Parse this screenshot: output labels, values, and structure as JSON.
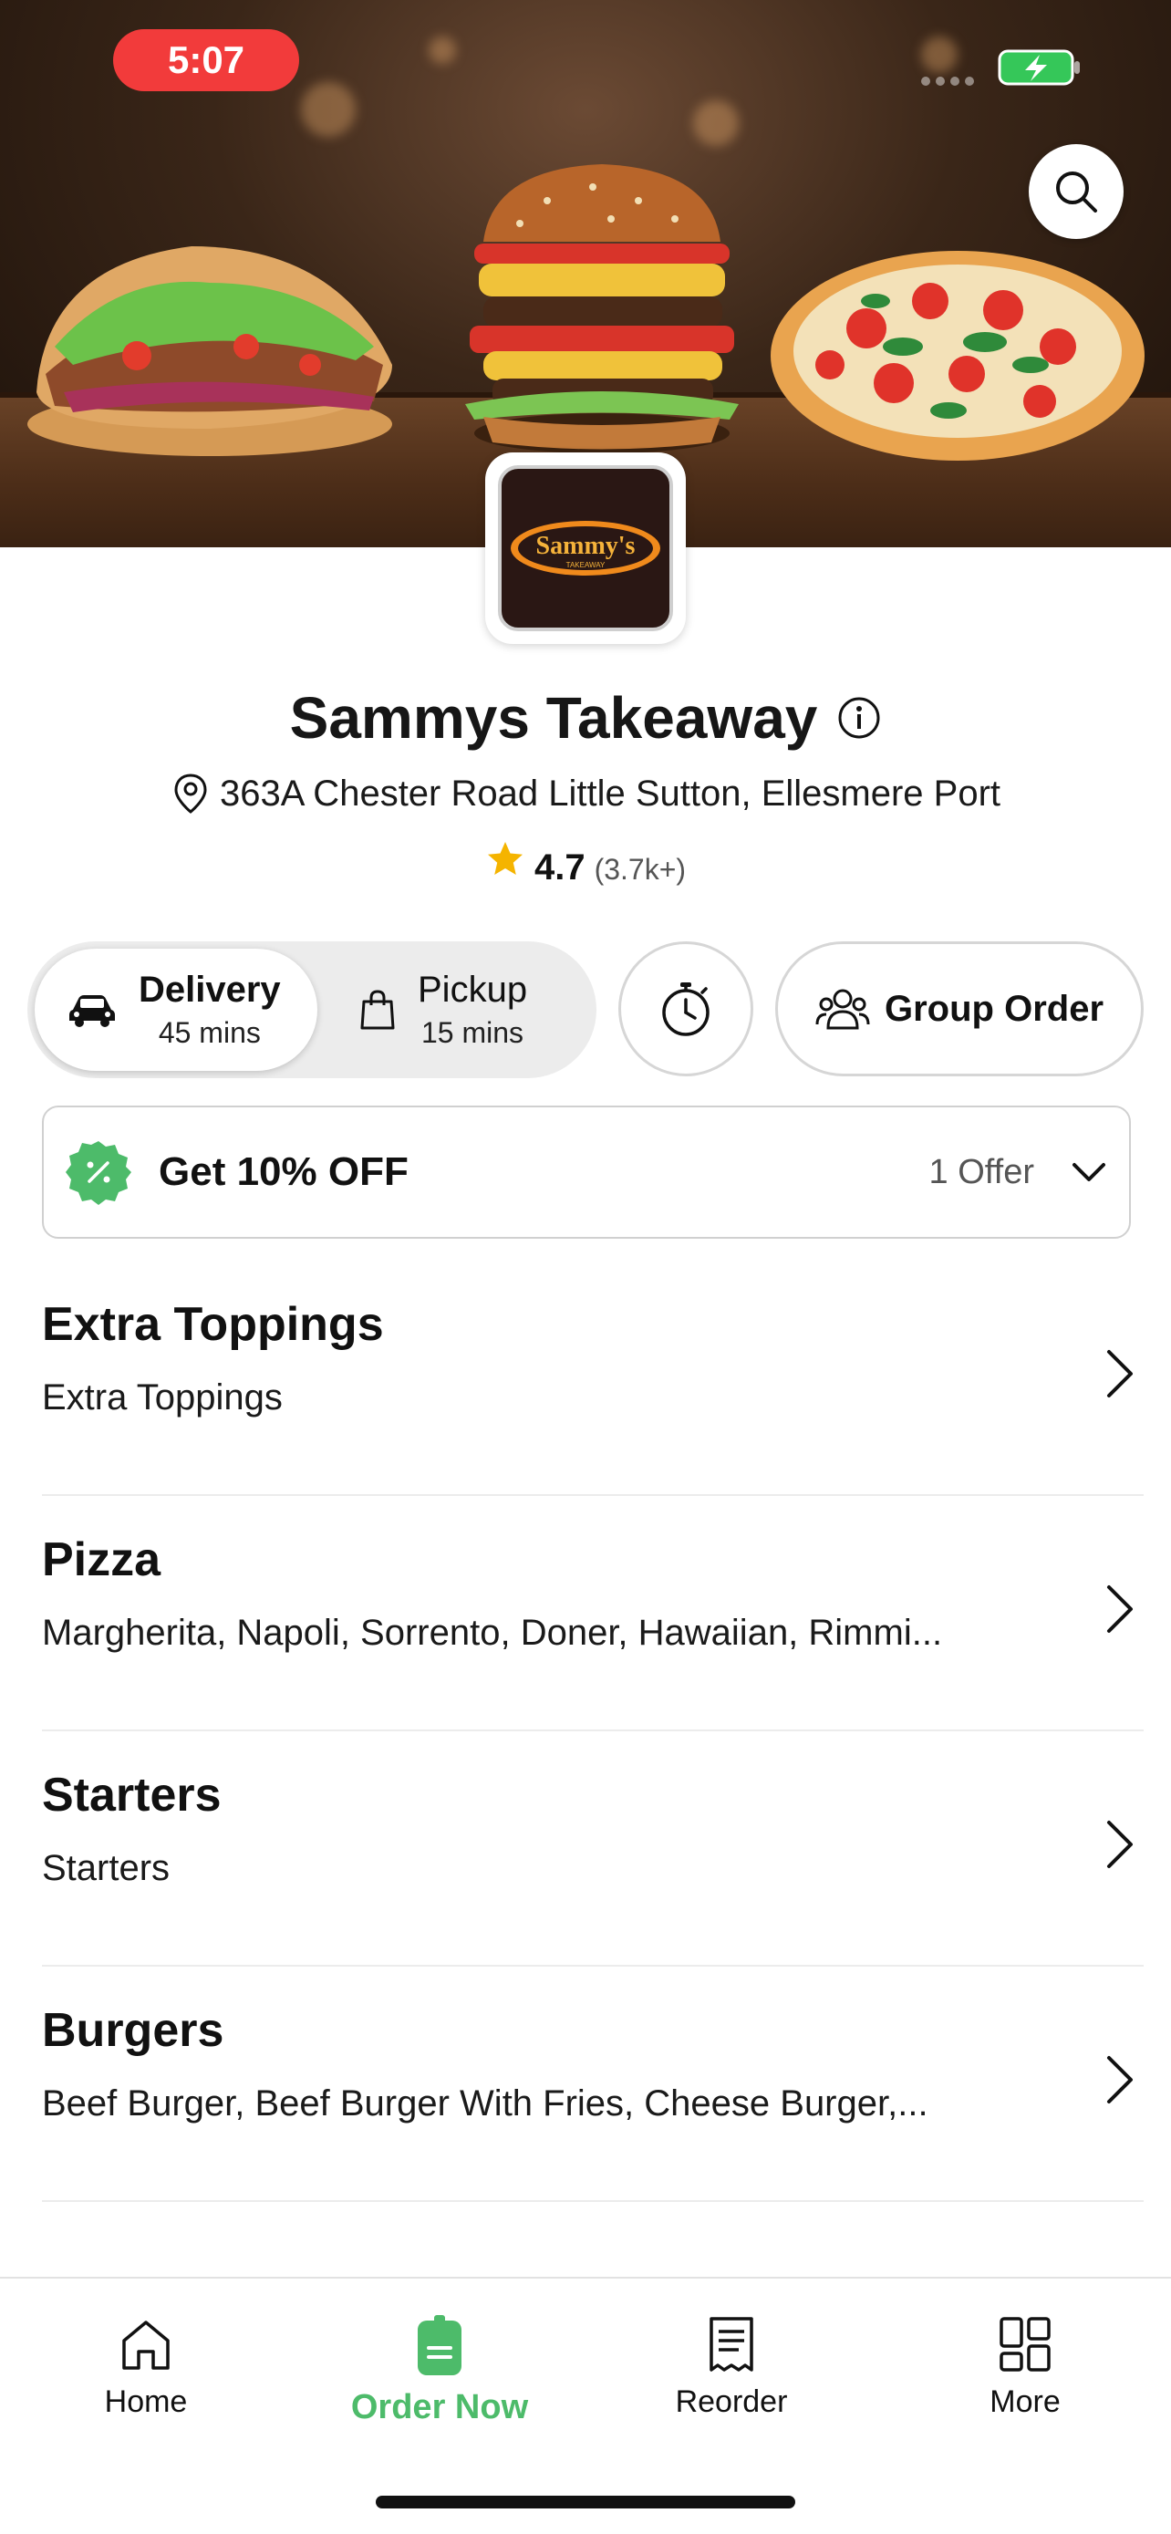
{
  "status": {
    "time": "5:07"
  },
  "restaurant": {
    "name": "Sammys Takeaway",
    "address": "363A Chester Road Little Sutton, Ellesmere Port",
    "rating": "4.7",
    "rating_count": "(3.7k+)",
    "logo_text": "Sammy's",
    "logo_subtext": "TAKEAWAY"
  },
  "modes": {
    "delivery": {
      "label": "Delivery",
      "time": "45 mins"
    },
    "pickup": {
      "label": "Pickup",
      "time": "15 mins"
    },
    "selected": "delivery"
  },
  "group_order": {
    "label": "Group Order"
  },
  "offer": {
    "title": "Get 10% OFF",
    "count": "1 Offer"
  },
  "categories": [
    {
      "title": "Extra Toppings",
      "desc": "Extra Toppings"
    },
    {
      "title": "Pizza",
      "desc": "Margherita, Napoli, Sorrento, Doner, Hawaiian, Rimmi..."
    },
    {
      "title": "Starters",
      "desc": "Starters"
    },
    {
      "title": "Burgers",
      "desc": "Beef Burger, Beef Burger With Fries, Cheese Burger,..."
    }
  ],
  "nav": {
    "items": [
      {
        "label": "Home",
        "icon": "home-icon"
      },
      {
        "label": "Order Now",
        "icon": "order-icon"
      },
      {
        "label": "Reorder",
        "icon": "receipt-icon"
      },
      {
        "label": "More",
        "icon": "grid-icon"
      }
    ],
    "active": "Order Now"
  },
  "colors": {
    "accent": "#4dbb6a",
    "status_pill": "#f23b3b",
    "star": "#f5b400"
  }
}
